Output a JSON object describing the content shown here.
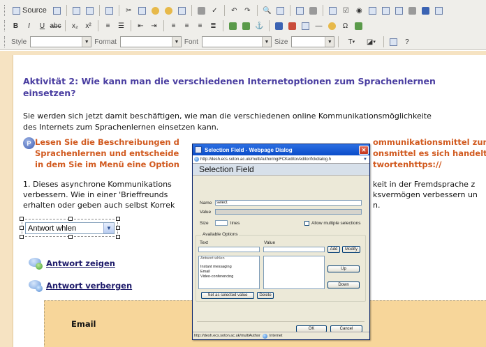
{
  "toolbar": {
    "source_label": "Source",
    "style_label": "Style",
    "format_label": "Format",
    "font_label": "Font",
    "size_label": "Size"
  },
  "document": {
    "heading": "Aktivität 2: Wie kann man die verschiedenen Internetoptionen zum Sprachenlernen einsetzen?",
    "intro_line1": "Sie werden sich jetzt damit beschäftigen, wie man die verschiedenen online Kommunikationsmöglichkeite",
    "intro_line2": "des Internets zum Sprachenlernen einsetzen kann.",
    "task_line1": "Lesen Sie die Beschreibungen d",
    "task_line2": "Sprachenlernen und entscheide",
    "task_line3": "in dem Sie im Menü eine Option",
    "task_right1": "ommunikationsmittel zur",
    "task_right2": "onsmittel es sich handelt",
    "task_right3": "twortenhttps://",
    "q1_line1": "1. Dieses asynchrone Kommunikations",
    "q1_line2": "verbessern. Wie in einer 'Brieffreunds",
    "q1_line3": "erhalten oder geben auch selbst Korrek",
    "q1_right1": "keit in der Fremdsprache z",
    "q1_right2": "ksvermögen verbessern un",
    "q1_right3": "n.",
    "select_value": "Antwort whlen",
    "show_answer": "Antwort zeigen",
    "hide_answer": "Antwort verbergen",
    "email_title": "Email"
  },
  "dialog": {
    "title": "Selection Field - Webpage Dialog",
    "url": "http://desh.ecs.soton.ac.uk/multiAuthoring/FCKeditor/editor/fckdialog.h",
    "heading": "Selection Field",
    "name_label": "Name",
    "name_value": "select",
    "value_label": "Value",
    "size_label": "Size",
    "lines_label": "lines",
    "allow_multiple_label": "Allow multiple selections",
    "available_options_label": "Available Options",
    "text_col_label": "Text",
    "value_col_label": "Value",
    "add_button": "Add",
    "modify_button": "Modify",
    "options": [
      "Antwort whlen",
      "",
      "Instant messaging",
      "Email",
      "Video-conferencing"
    ],
    "up_button": "Up",
    "down_button": "Down",
    "set_selected_button": "Set as selected value",
    "delete_button": "Delete",
    "ok_button": "OK",
    "cancel_button": "Cancel",
    "status_url": "http://desh.ecs.soton.ac.uk/multiAuthor",
    "status_zone": "Internet"
  }
}
